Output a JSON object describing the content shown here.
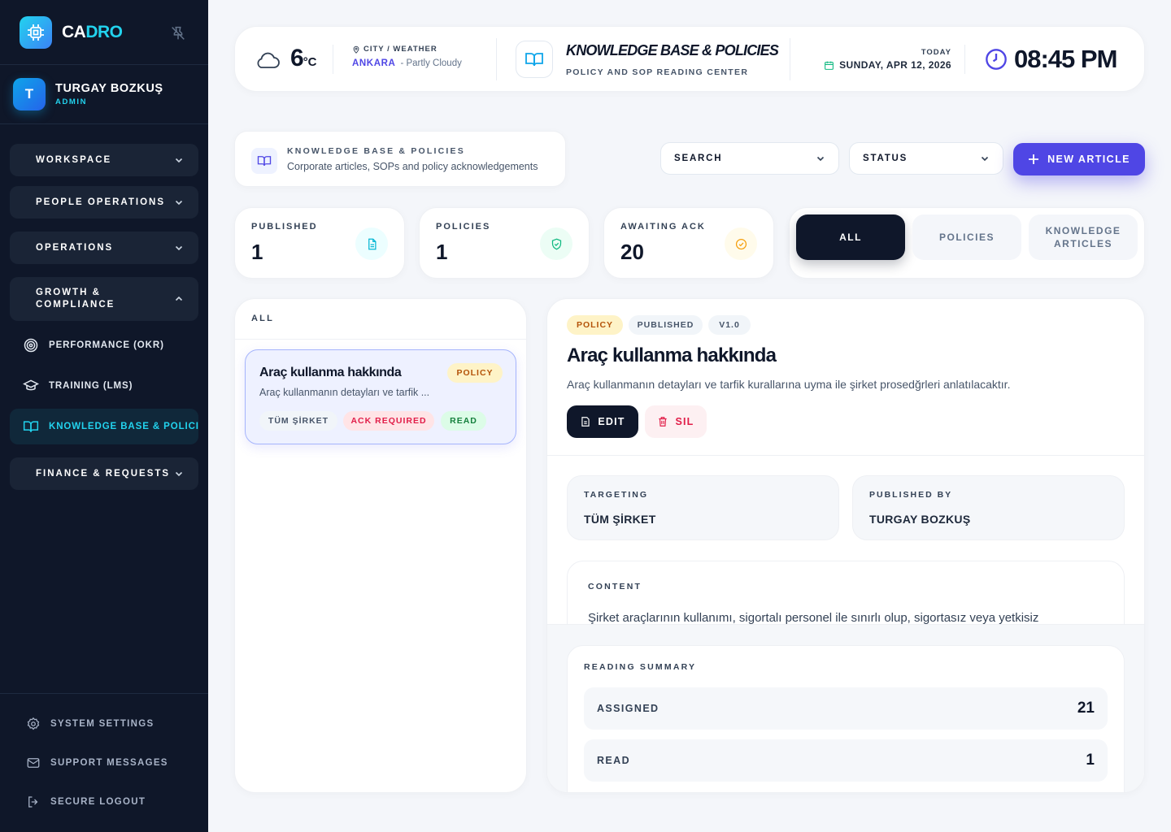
{
  "app": {
    "brand_a": "CA",
    "brand_b": "DRO"
  },
  "user": {
    "initial": "T",
    "name": "TURGAY BOZKUŞ",
    "role": "ADMIN"
  },
  "sidebar": {
    "groups": [
      {
        "label": "WORKSPACE"
      },
      {
        "label": "PEOPLE OPERATIONS"
      },
      {
        "label": "OPERATIONS"
      },
      {
        "label": "GROWTH &\nCOMPLIANCE"
      },
      {
        "label": "FINANCE & REQUESTS"
      }
    ],
    "items": [
      {
        "label": "PERFORMANCE (OKR)",
        "icon": "target-icon"
      },
      {
        "label": "TRAINING (LMS)",
        "icon": "graduation-cap-icon"
      },
      {
        "label": "KNOWLEDGE BASE & POLICIES",
        "icon": "book-open-icon",
        "active": true
      }
    ],
    "footer": [
      {
        "label": "SYSTEM SETTINGS",
        "icon": "gear-icon"
      },
      {
        "label": "SUPPORT MESSAGES",
        "icon": "mail-icon"
      },
      {
        "label": "SECURE LOGOUT",
        "icon": "logout-icon"
      }
    ]
  },
  "topbar": {
    "temp": "6",
    "temp_unit": "°C",
    "city_label": "CITY / WEATHER",
    "city": "ANKARA",
    "condition": "- Partly Cloudy",
    "module_title": "KNOWLEDGE BASE & POLICIES",
    "module_sub": "POLICY AND SOP READING CENTER",
    "today_label": "TODAY",
    "date": "SUNDAY, APR 12, 2026",
    "time": "08:45 PM"
  },
  "pagehead": {
    "title": "KNOWLEDGE BASE & POLICIES",
    "subtitle": "Corporate articles, SOPs and policy acknowledgements"
  },
  "filters": {
    "search": "SEARCH",
    "status": "STATUS",
    "new_button": "NEW ARTICLE"
  },
  "stats": [
    {
      "label": "PUBLISHED",
      "value": "1",
      "icon": "document-icon",
      "color": "#06b6d4"
    },
    {
      "label": "POLICIES",
      "value": "1",
      "icon": "shield-check-icon",
      "color": "#10b981"
    },
    {
      "label": "AWAITING ACK",
      "value": "20",
      "icon": "check-circle-icon",
      "color": "#f59e0b"
    }
  ],
  "tabs": [
    {
      "label": "ALL",
      "active": true
    },
    {
      "label": "POLICIES"
    },
    {
      "label": "KNOWLEDGE\nARTICLES"
    }
  ],
  "list": {
    "header": "ALL",
    "articles": [
      {
        "title": "Araç kullanma hakkında",
        "desc": "Araç kullanmanın detayları ve tarfik ...",
        "type": "POLICY",
        "tags": [
          "TÜM ŞİRKET",
          "ACK REQUIRED",
          "READ"
        ]
      }
    ]
  },
  "detail": {
    "badges": [
      "POLICY",
      "PUBLISHED",
      "V1.0"
    ],
    "title": "Araç kullanma hakkında",
    "description": "Araç kullanmanın detayları ve tarfik kurallarına uyma ile şirket prosedğrleri anlatılacaktır.",
    "edit": "EDIT",
    "delete": "SIL",
    "targeting_label": "TARGETING",
    "targeting": "TÜM ŞİRKET",
    "published_by_label": "PUBLISHED BY",
    "published_by": "TURGAY BOZKUŞ",
    "content_label": "CONTENT",
    "content": "Şirket araçlarının kullanımı, sigortalı personel ile sınırlı olup, sigortasız veya yetkisiz",
    "summary_label": "READING SUMMARY",
    "summary": [
      {
        "label": "ASSIGNED",
        "value": "21"
      },
      {
        "label": "READ",
        "value": "1"
      }
    ]
  },
  "colors": {
    "accent": "#4f46e5",
    "cyan": "#22d3ee",
    "sidebar_bg": "#0f1729",
    "danger": "#e11d48",
    "success": "#10b981",
    "warning": "#f59e0b"
  }
}
